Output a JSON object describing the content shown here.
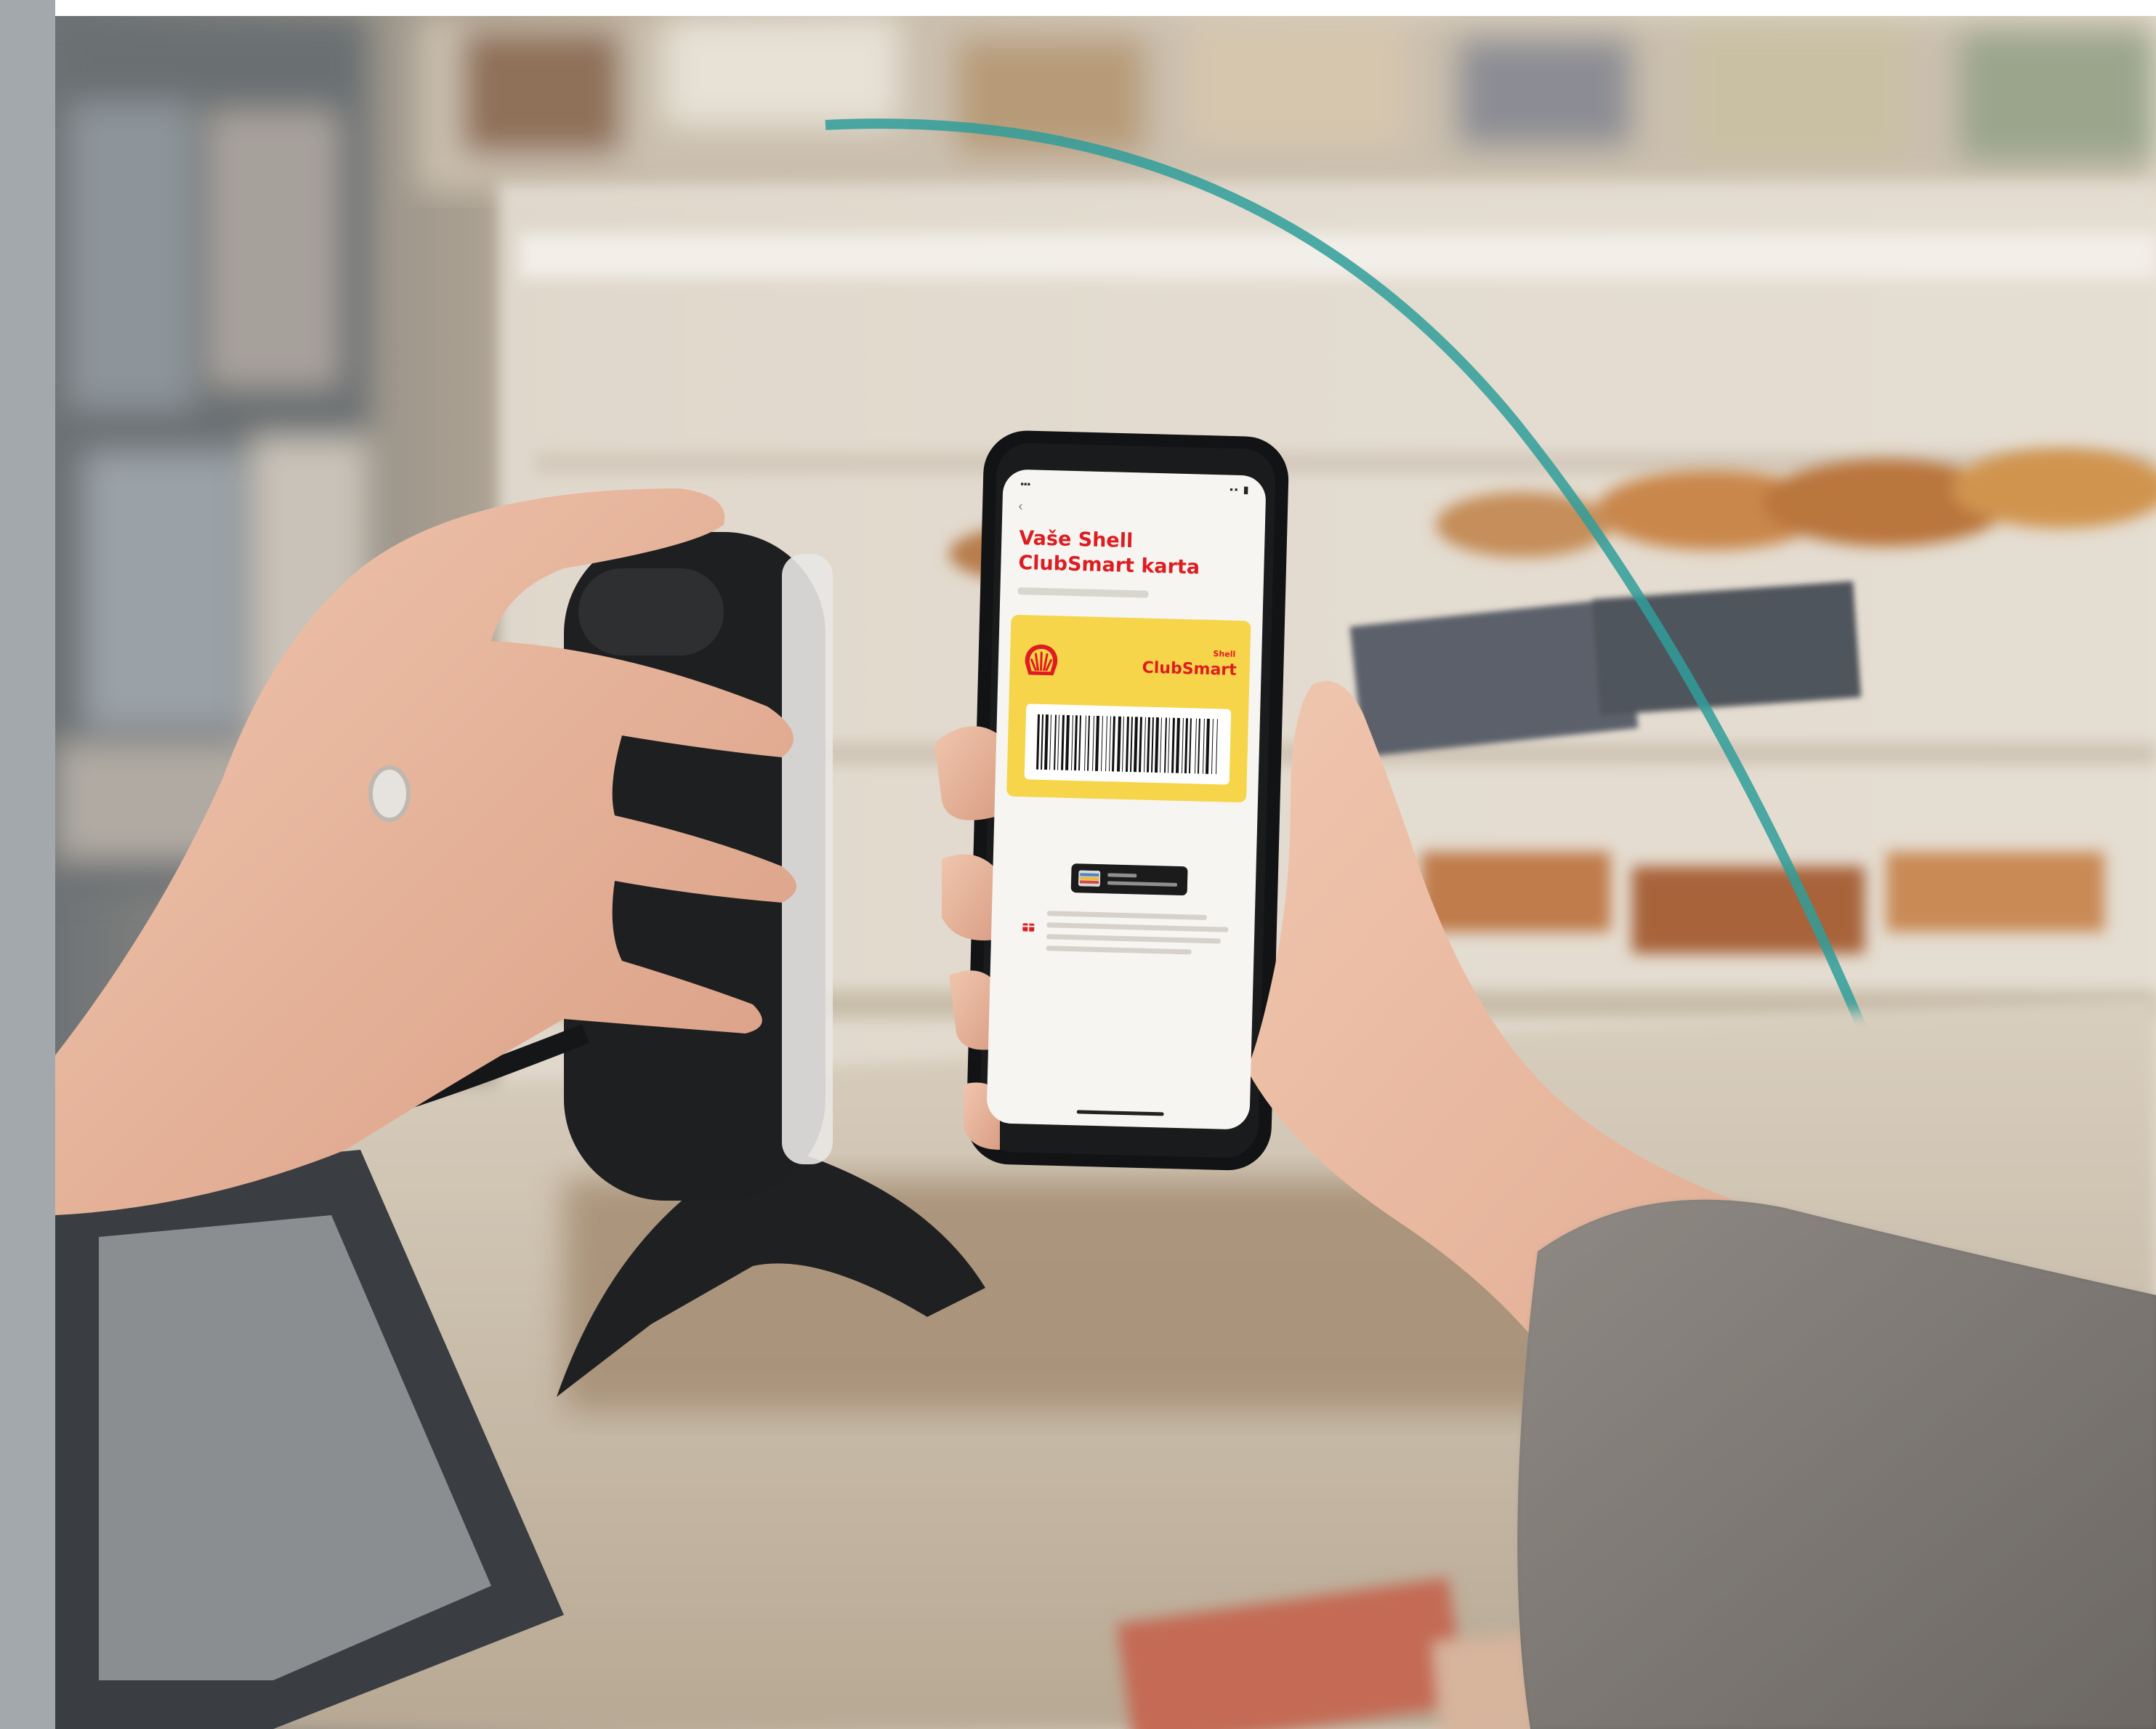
{
  "phone_screen": {
    "title": "Vaše Shell ClubSmart karta",
    "card": {
      "brand_small": "Shell",
      "brand_big": "ClubSmart"
    }
  },
  "colors": {
    "shell_red": "#dd1d21",
    "shell_yellow": "#f6d54a",
    "teal_glass_edge": "#2f9e9a",
    "left_strip": "#a3a8ad"
  }
}
